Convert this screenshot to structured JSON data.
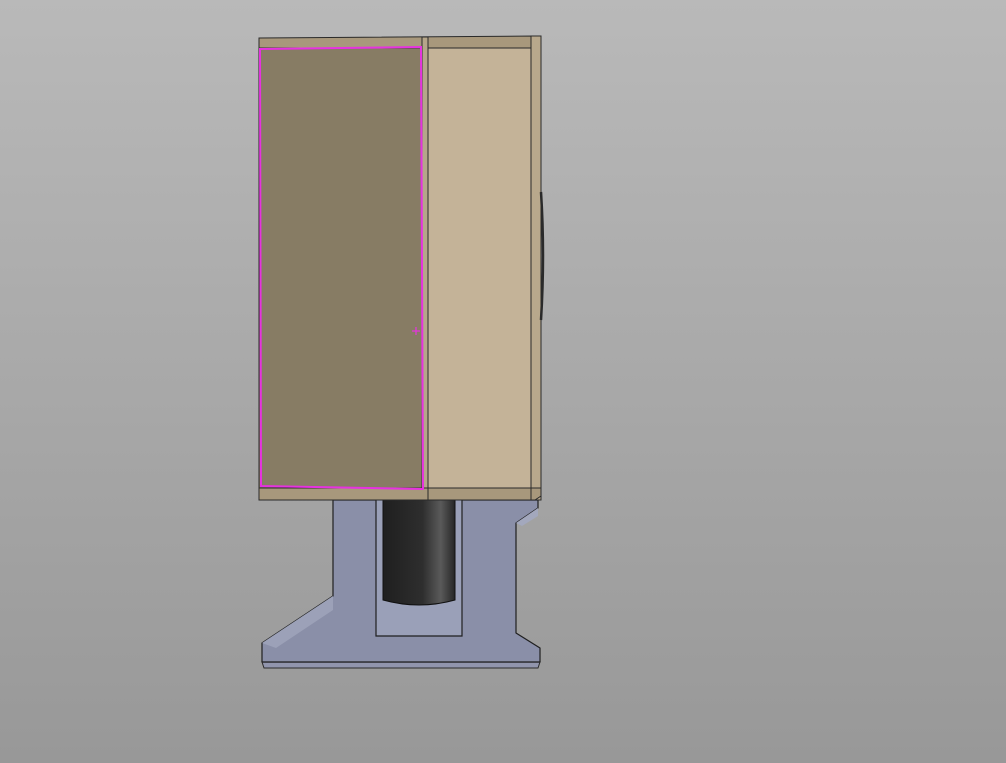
{
  "viewport": {
    "background": {
      "top": "#b9b9b9",
      "bottom": "#989898"
    }
  },
  "model": {
    "components": [
      {
        "name": "cabinet-top-rail",
        "color": "#a8987c"
      },
      {
        "name": "cabinet-front-face",
        "color": "#877c64",
        "selected": true
      },
      {
        "name": "cabinet-side-panel",
        "color": "#c4b398"
      },
      {
        "name": "cabinet-bottom-rail",
        "color": "#a8987c"
      },
      {
        "name": "stand-bracket",
        "color": "#8a8fa8"
      },
      {
        "name": "motor-cylinder",
        "color": "#2f2f2f"
      },
      {
        "name": "base-plate",
        "color": "#9195ad"
      }
    ],
    "selection": {
      "highlight_color": "#e632e0",
      "target": "cabinet-front-face"
    }
  }
}
